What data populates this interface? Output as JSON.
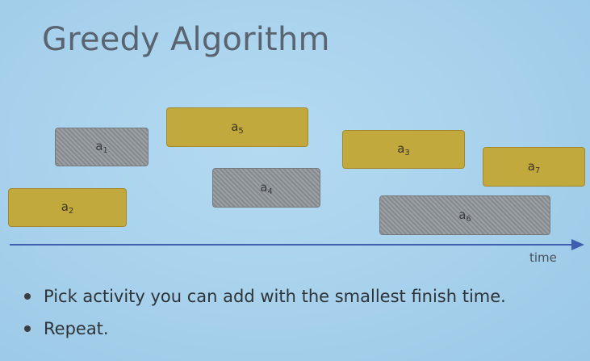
{
  "title": "Greedy Algorithm",
  "colors": {
    "background": "#a9d3ee",
    "gold_activity": "#c2a93d",
    "gray_activity": "#8c9196",
    "axis": "#3f5fae"
  },
  "activities": [
    {
      "id": "a1",
      "base": "a",
      "sub": "1",
      "style": "gray"
    },
    {
      "id": "a2",
      "base": "a",
      "sub": "2",
      "style": "gold"
    },
    {
      "id": "a3",
      "base": "a",
      "sub": "3",
      "style": "gold"
    },
    {
      "id": "a4",
      "base": "a",
      "sub": "4",
      "style": "gray"
    },
    {
      "id": "a5",
      "base": "a",
      "sub": "5",
      "style": "gold"
    },
    {
      "id": "a6",
      "base": "a",
      "sub": "6",
      "style": "gray"
    },
    {
      "id": "a7",
      "base": "a",
      "sub": "7",
      "style": "gold"
    }
  ],
  "axis": {
    "label": "time"
  },
  "bullets": [
    "Pick activity you can add with the smallest finish time.",
    "Repeat."
  ]
}
